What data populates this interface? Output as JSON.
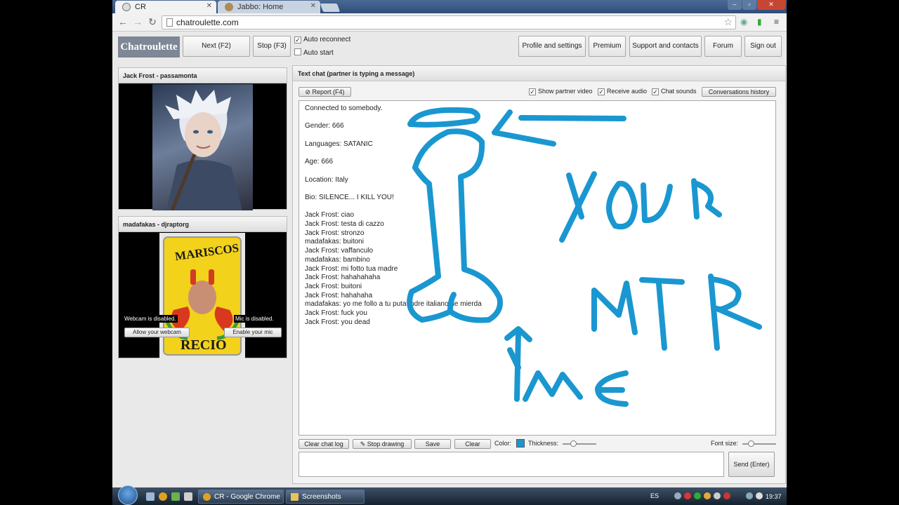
{
  "browser": {
    "tabs": [
      {
        "label": "CR"
      },
      {
        "label": "Jabbo: Home"
      }
    ],
    "url": "chatroulette.com"
  },
  "header": {
    "logo": "Chatroulette",
    "next_label": "Next (F2)",
    "stop_label": "Stop (F3)",
    "auto_reconnect": {
      "label": "Auto reconnect",
      "checked": true
    },
    "auto_start": {
      "label": "Auto start",
      "checked": false
    },
    "nav": [
      "Profile and settings",
      "Premium",
      "Support and contacts",
      "Forum",
      "Sign out"
    ]
  },
  "partner_video": {
    "title": "Jack Frost - passamonta"
  },
  "own_video": {
    "title": "madafakas - djraptorg",
    "webcam_note": "Webcam is disabled.",
    "mic_note": "Mic is disabled.",
    "webcam_button": "Allow your webcam",
    "mic_button": "Enable your mic",
    "image_text": "MARISCOS RECIO"
  },
  "chat": {
    "title": "Text chat (partner is typing a message)",
    "report_label": "Report (F4)",
    "options": [
      {
        "label": "Show partner video",
        "checked": true
      },
      {
        "label": "Receive audio",
        "checked": true
      },
      {
        "label": "Chat sounds",
        "checked": true
      }
    ],
    "history_label": "Conversations history",
    "info_lines": [
      "Connected to somebody.",
      "Gender: 666",
      "Languages: SATANIC",
      "Age: 666",
      "Location: Italy",
      "Bio: SILENCE... I KILL YOU!"
    ],
    "messages": [
      "Jack Frost: ciao",
      "Jack Frost: testa di cazzo",
      "Jack Frost: stronzo",
      "madafakas: buitoni",
      "Jack Frost: vaffanculo",
      "madafakas: bambino",
      "Jack Frost: mi fotto tua madre",
      "Jack Frost: hahahahaha",
      "Jack Frost: buitoni",
      "Jack Frost: hahahaha",
      "madafakas: yo me follo a tu puta mdre italiano de mierda",
      "Jack Frost: fuck you",
      "Jack Frost: you dead"
    ],
    "toolbar": {
      "clear_log": "Clear chat log",
      "stop_drawing": "Stop drawing",
      "save": "Save",
      "clear": "Clear",
      "color_label": "Color:",
      "thickness_label": "Thickness:",
      "font_size_label": "Font size:"
    },
    "draw_color": "#1a97d0",
    "send_label": "Send (Enter)"
  },
  "taskbar": {
    "tasks": [
      "CR - Google Chrome",
      "Screenshots"
    ],
    "language": "ES",
    "clock": "19:37"
  }
}
